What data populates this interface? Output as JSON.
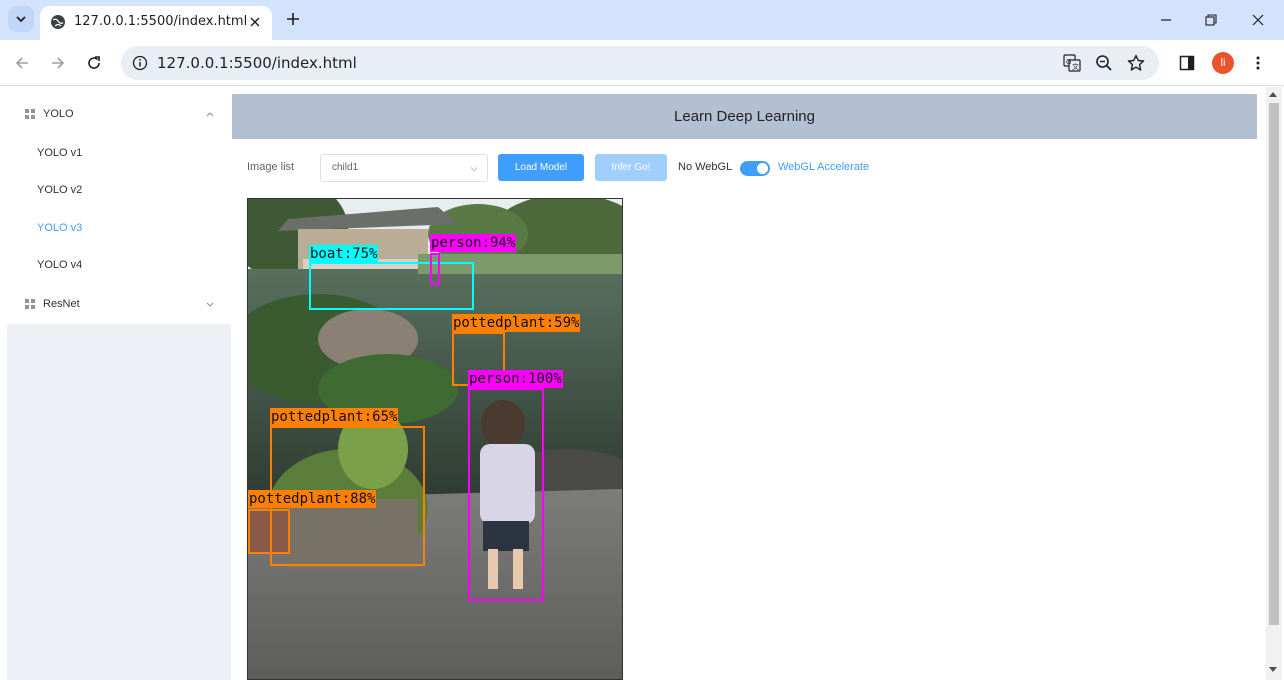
{
  "browser": {
    "tab_title": "127.0.0.1:5500/index.html",
    "url": "127.0.0.1:5500/index.html",
    "profile_initial": "li"
  },
  "sidebar": {
    "groups": [
      {
        "label": "YOLO",
        "expanded": true,
        "items": [
          {
            "label": "YOLO v1",
            "active": false
          },
          {
            "label": "YOLO v2",
            "active": false
          },
          {
            "label": "YOLO v3",
            "active": true
          },
          {
            "label": "YOLO v4",
            "active": false
          }
        ]
      },
      {
        "label": "ResNet",
        "expanded": false,
        "items": []
      }
    ]
  },
  "header": {
    "title": "Learn Deep Learning"
  },
  "controls": {
    "image_list_label": "Image list",
    "image_selected": "child1",
    "load_model_label": "Load Model",
    "infer_label": "Infer Go!",
    "no_webgl_label": "No WebGL",
    "webgl_label": "WebGL Accelerate",
    "webgl_enabled": true
  },
  "detections": [
    {
      "label": "boat:75%",
      "color": "#00ffff"
    },
    {
      "label": "person:94%",
      "color": "#ff00ff"
    },
    {
      "label": "pottedplant:59%",
      "color": "#ff8000"
    },
    {
      "label": "person:100%",
      "color": "#ff00ff"
    },
    {
      "label": "pottedplant:65%",
      "color": "#ff8000"
    },
    {
      "label": "pottedplant:88%",
      "color": "#ff8000"
    }
  ],
  "colors": {
    "accent": "#409eff",
    "header_bg": "#b3c0d1",
    "chrome_bg": "#d3e3fd"
  }
}
